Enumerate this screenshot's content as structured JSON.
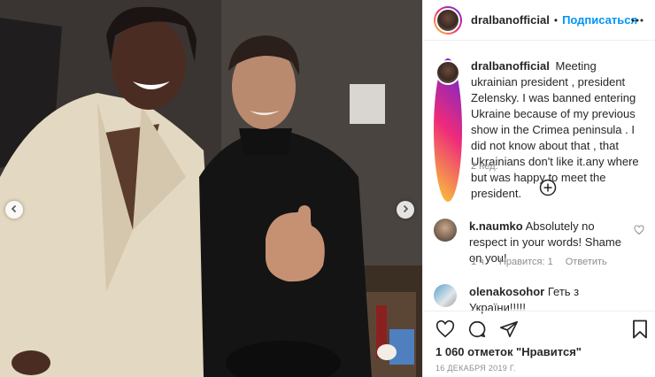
{
  "post": {
    "author": "dralbanofficial",
    "follow_label": "Подписаться",
    "separator": "•",
    "caption": "Meeting ukrainian president , president Zelensky. I was banned entering Ukraine because of my previous show in the Crimea peninsula . I did not know about that , that Ukrainians don't like it.any where but was happy to meet the president.",
    "caption_time": "2 нед.",
    "likes_text": "1 060 отметок \"Нравится\"",
    "date_text": "16 ДЕКАБРЯ 2019 Г."
  },
  "comments": [
    {
      "user": "k.naumko",
      "text": "Absolutely no respect in your words! Shame on you!",
      "time": "1 ч.",
      "likes": "Нравится: 1",
      "reply_label": "Ответить"
    },
    {
      "user": "olenakosohor",
      "text": "Геть з України!!!!!"
    }
  ],
  "icons": {
    "nav_prev": "chevron-left-icon",
    "nav_next": "chevron-right-icon",
    "more": "more-options-icon",
    "load_more": "plus-circle-icon",
    "like": "heart-icon",
    "comment": "comment-icon",
    "share": "send-icon",
    "save": "bookmark-icon"
  },
  "colors": {
    "link_blue": "#0095f6",
    "text": "#262626",
    "muted": "#8e8e8e",
    "border": "#efefef"
  }
}
